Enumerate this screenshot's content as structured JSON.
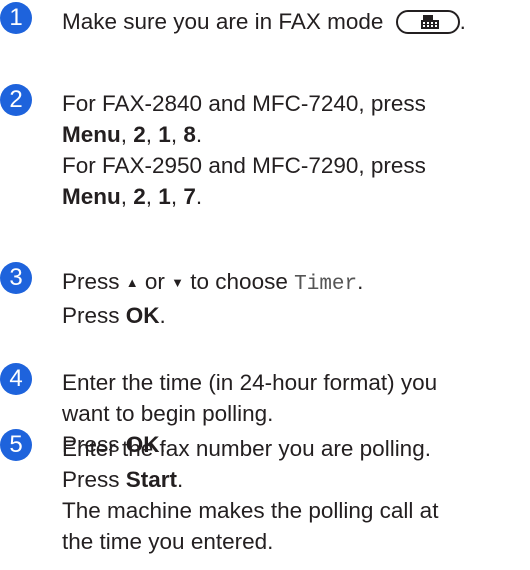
{
  "steps": [
    {
      "number": "1",
      "intro": "Make sure you are in FAX mode",
      "icon": "fax-icon"
    },
    {
      "number": "2",
      "a_prefix": "For FAX-2840 and MFC-7240, press",
      "a_menu": "Menu",
      "a_k1": "2",
      "a_k2": "1",
      "a_k3": "8",
      "b_prefix": "For FAX-2950 and MFC-7290, press",
      "b_menu": "Menu",
      "b_k1": "2",
      "b_k2": "1",
      "b_k3": "7",
      "sep": ", ",
      "end": "."
    },
    {
      "number": "3",
      "press": "Press ",
      "up_arrow": "▲",
      "or": " or ",
      "down_arrow": "▼",
      "to_choose": " to choose ",
      "option": "Timer",
      "end": ".",
      "press2": "Press ",
      "key": "OK",
      "end2": "."
    },
    {
      "number": "4",
      "line1": "Enter the time (in 24-hour format) you",
      "line2": "want to begin polling.",
      "press": "Press ",
      "key": "OK",
      "end": "."
    },
    {
      "number": "5",
      "line1": "Enter the fax number you are polling.",
      "press": "Press ",
      "key": "Start",
      "end": ".",
      "line3": "The machine makes the polling call at",
      "line4": "the time you entered."
    }
  ]
}
